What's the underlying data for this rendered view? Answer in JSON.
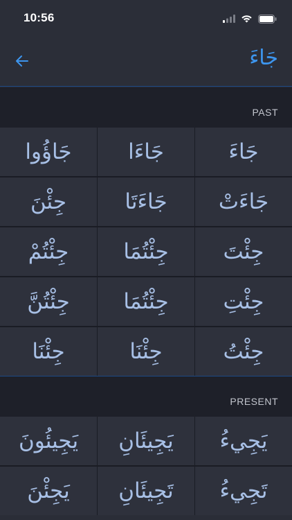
{
  "status": {
    "time": "10:56"
  },
  "nav": {
    "title": "جَاءَ"
  },
  "past": {
    "label": "PAST",
    "cells": [
      "جَاءَ",
      "جَاءَا",
      "جَاؤُوا",
      "جَاءَتْ",
      "جَاءَتَا",
      "جِئْنَ",
      "جِئْتَ",
      "جِئْتُمَا",
      "جِئْتُمْ",
      "جِئْتِ",
      "جِئْتُمَا",
      "جِئْتُنَّ",
      "جِئْتُ",
      "جِئْنَا",
      "جِئْنَا"
    ]
  },
  "present": {
    "label": "PRESENT",
    "cells": [
      "يَجِيءُ",
      "يَجِيئَانِ",
      "يَجِيئُونَ",
      "تَجِيءُ",
      "تَجِيئَانِ",
      "يَجِئْنَ"
    ]
  },
  "icons": {
    "back": "arrow-left-icon",
    "signal": "signal-icon",
    "wifi": "wifi-icon",
    "battery": "battery-icon"
  },
  "colors": {
    "accent": "#3d96ef",
    "cell_text": "#a8c0e6"
  }
}
